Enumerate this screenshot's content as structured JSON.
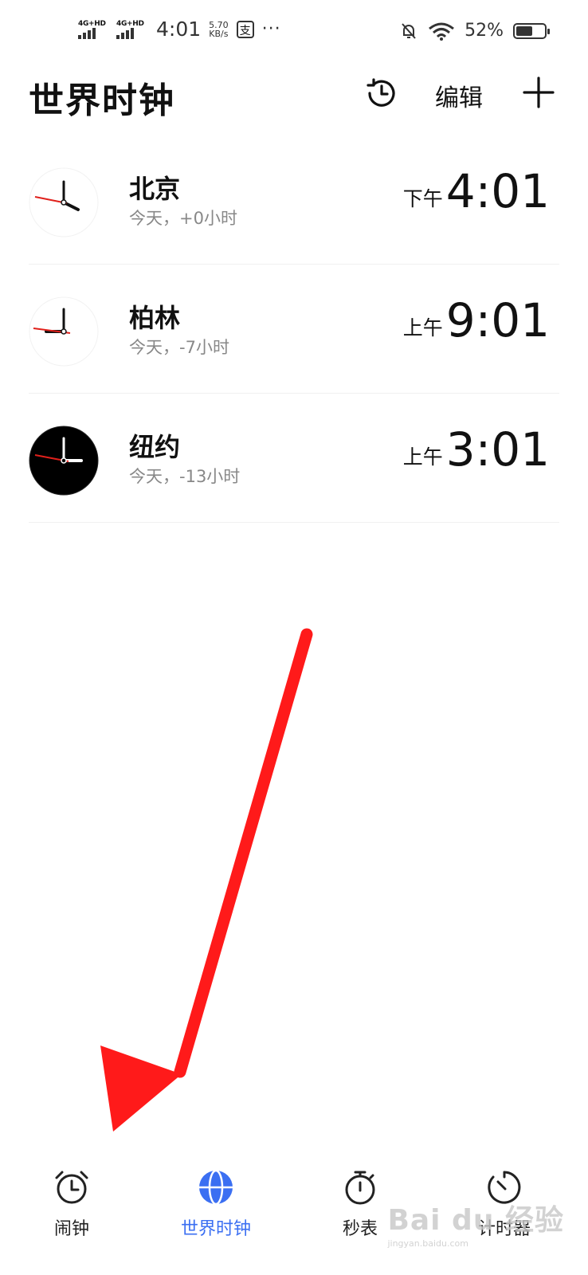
{
  "status_bar": {
    "sim1": "4G+HD",
    "sim2": "4G+HD",
    "time": "4:01",
    "speed_value": "5.70",
    "speed_unit": "KB/s",
    "pay_icon_text": "支",
    "more": "···",
    "battery": "52%"
  },
  "header": {
    "title": "世界时钟",
    "edit_label": "编辑"
  },
  "clocks": [
    {
      "city": "北京",
      "offset": "今天，+0小时",
      "ampm": "下午",
      "time": "4:01",
      "dark": false
    },
    {
      "city": "柏林",
      "offset": "今天，-7小时",
      "ampm": "上午",
      "time": "9:01",
      "dark": false
    },
    {
      "city": "纽约",
      "offset": "今天，-13小时",
      "ampm": "上午",
      "time": "3:01",
      "dark": true
    }
  ],
  "tabs": [
    {
      "label": "闹钟",
      "icon": "alarm-clock-icon",
      "active": false
    },
    {
      "label": "世界时钟",
      "icon": "globe-icon",
      "active": true
    },
    {
      "label": "秒表",
      "icon": "stopwatch-icon",
      "active": false
    },
    {
      "label": "计时器",
      "icon": "timer-icon",
      "active": false
    }
  ],
  "watermark": {
    "text": "Bai du 经验",
    "sub": "jingyan.baidu.com"
  },
  "colors": {
    "accent": "#3b6ff2",
    "second_hand": "#e0201b",
    "annotation_arrow": "#ff1a1a"
  }
}
